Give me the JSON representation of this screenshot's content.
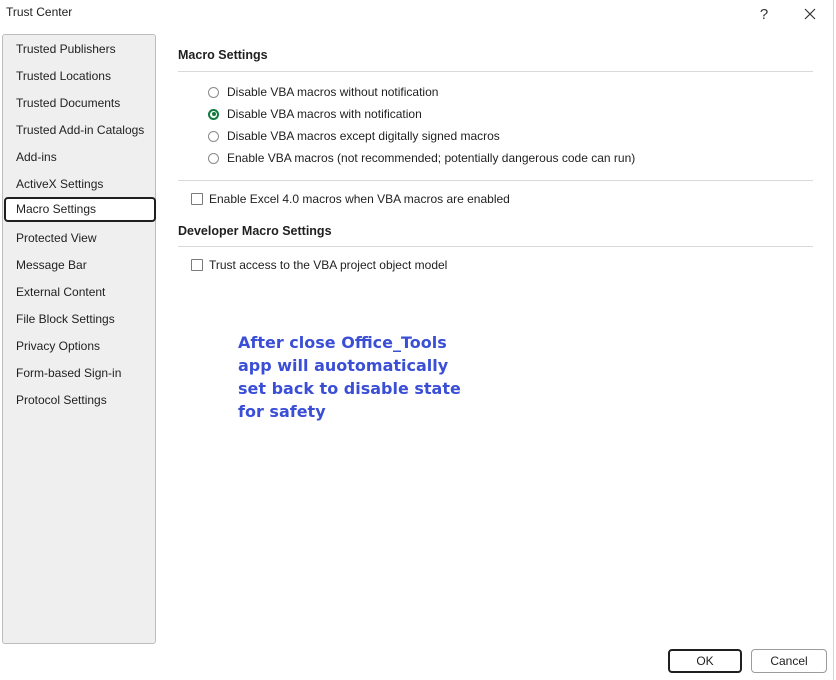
{
  "window": {
    "title": "Trust Center",
    "help_label": "?"
  },
  "sidebar": {
    "items": [
      {
        "label": "Trusted Publishers"
      },
      {
        "label": "Trusted Locations"
      },
      {
        "label": "Trusted Documents"
      },
      {
        "label": "Trusted Add-in Catalogs"
      },
      {
        "label": "Add-ins"
      },
      {
        "label": "ActiveX Settings"
      },
      {
        "label": "Macro Settings"
      },
      {
        "label": "Protected View"
      },
      {
        "label": "Message Bar"
      },
      {
        "label": "External Content"
      },
      {
        "label": "File Block Settings"
      },
      {
        "label": "Privacy Options"
      },
      {
        "label": "Form-based Sign-in"
      },
      {
        "label": "Protocol Settings"
      }
    ],
    "selected": "Macro Settings"
  },
  "macro_settings": {
    "heading": "Macro Settings",
    "options": [
      {
        "label": "Disable VBA macros without notification",
        "selected": false
      },
      {
        "label": "Disable VBA macros with notification",
        "selected": true
      },
      {
        "label": "Disable VBA macros except digitally signed macros",
        "selected": false
      },
      {
        "label": "Enable VBA macros (not recommended; potentially dangerous code can run)",
        "selected": false
      }
    ],
    "excel4_checkbox": {
      "label": "Enable Excel 4.0 macros when VBA macros are enabled",
      "checked": false
    }
  },
  "developer_settings": {
    "heading": "Developer Macro Settings",
    "vba_access_checkbox": {
      "label": "Trust access to the VBA project object model",
      "checked": false
    }
  },
  "annotation": {
    "text": "After close Office_Tools app will auotomatically set back to disable state for safety",
    "color": "#3a4fd6"
  },
  "buttons": {
    "ok": "OK",
    "cancel": "Cancel"
  },
  "colors": {
    "accent_radio": "#0f7b3e",
    "sidebar_bg": "#efefef"
  }
}
